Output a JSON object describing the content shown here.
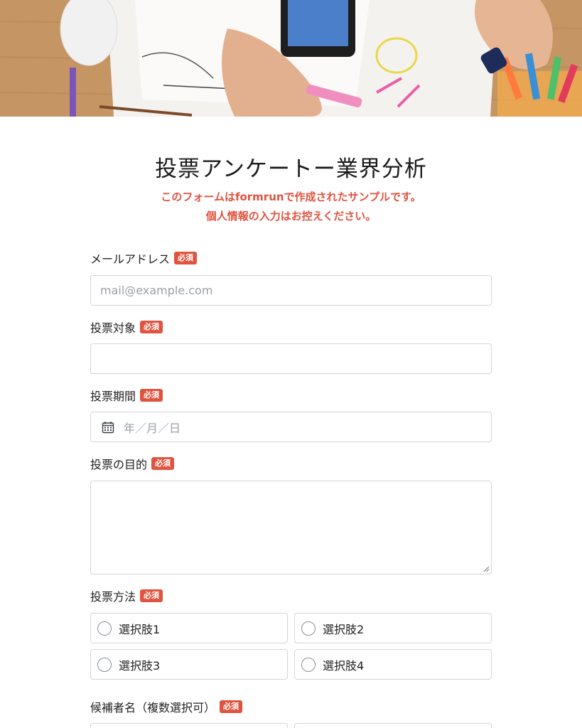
{
  "hero": {
    "alt": "desk-with-papers-phone-markers"
  },
  "form": {
    "title": "投票アンケートー業界分析",
    "notice_line1": "このフォームはformrunで作成されたサンプルです。",
    "notice_line2": "個人情報の入力はお控えください。",
    "required_badge": "必須",
    "fields": {
      "email": {
        "label": "メールアドレス",
        "placeholder": "mail@example.com"
      },
      "target": {
        "label": "投票対象"
      },
      "period": {
        "label": "投票期間",
        "placeholder": "年／月／日"
      },
      "purpose": {
        "label": "投票の目的"
      },
      "method": {
        "label": "投票方法",
        "options": [
          "選択肢1",
          "選択肢2",
          "選択肢3",
          "選択肢4"
        ]
      },
      "candidates": {
        "label": "候補者名（複数選択可）"
      }
    }
  },
  "colors": {
    "accent": "#e0533f",
    "border": "#d3d6da",
    "placeholder": "#9aa0a6"
  }
}
